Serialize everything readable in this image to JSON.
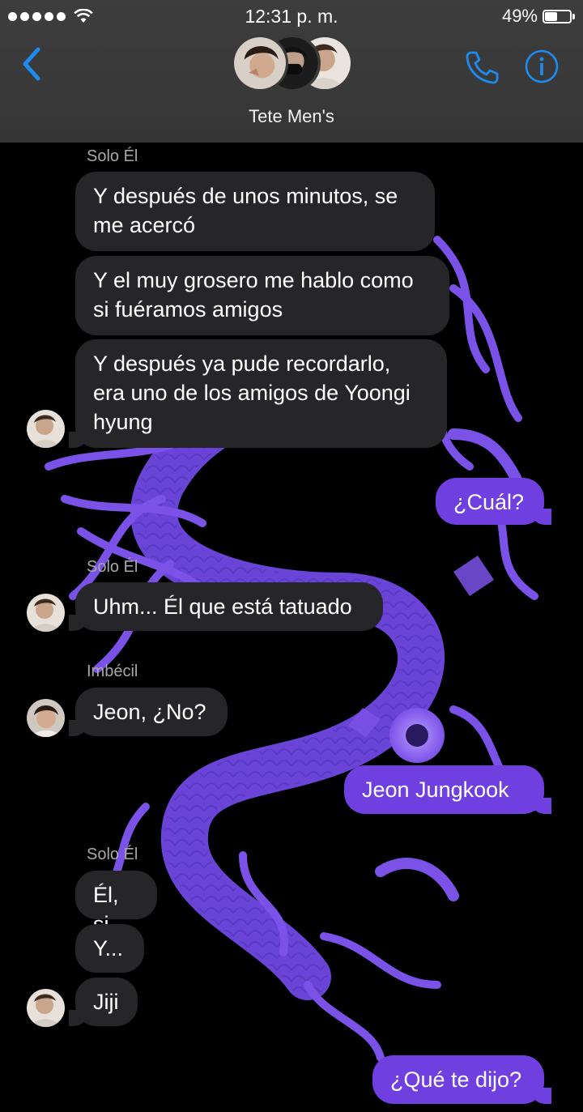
{
  "status_bar": {
    "time": "12:31 p. m.",
    "battery_text": "49%",
    "battery_level": 0.49
  },
  "header": {
    "group_name": "Tete Men's",
    "icons": [
      "back-chevron-icon",
      "phone-icon",
      "info-icon"
    ],
    "accent": "#1d8cf0"
  },
  "colors": {
    "incoming_bubble": "#262629",
    "outgoing_bubble": "#6f3fe0",
    "background": "#000000",
    "dragon": "#7b52e8"
  },
  "messages": [
    {
      "sender": "Solo Él"
    },
    {
      "text": "Y después de unos minutos, se\nme acercó"
    },
    {
      "text": "Y el muy grosero me hablo como\nsi fuéramos amigos"
    },
    {
      "text": "Y después ya pude recordarlo,\nera uno de los amigos de Yoongi\nhyung"
    },
    {
      "text": "¿Cuál?"
    },
    {
      "sender": "Solo Él"
    },
    {
      "text": "Uhm... Él que está tatuado"
    },
    {
      "sender": "Imbécil"
    },
    {
      "text": "Jeon, ¿No?"
    },
    {
      "text": "Jeon Jungkook"
    },
    {
      "sender": "Solo Él"
    },
    {
      "text": "Él, si"
    },
    {
      "text": "Y..."
    },
    {
      "text": "Jiji"
    },
    {
      "text": "¿Qué te dijo?"
    }
  ]
}
